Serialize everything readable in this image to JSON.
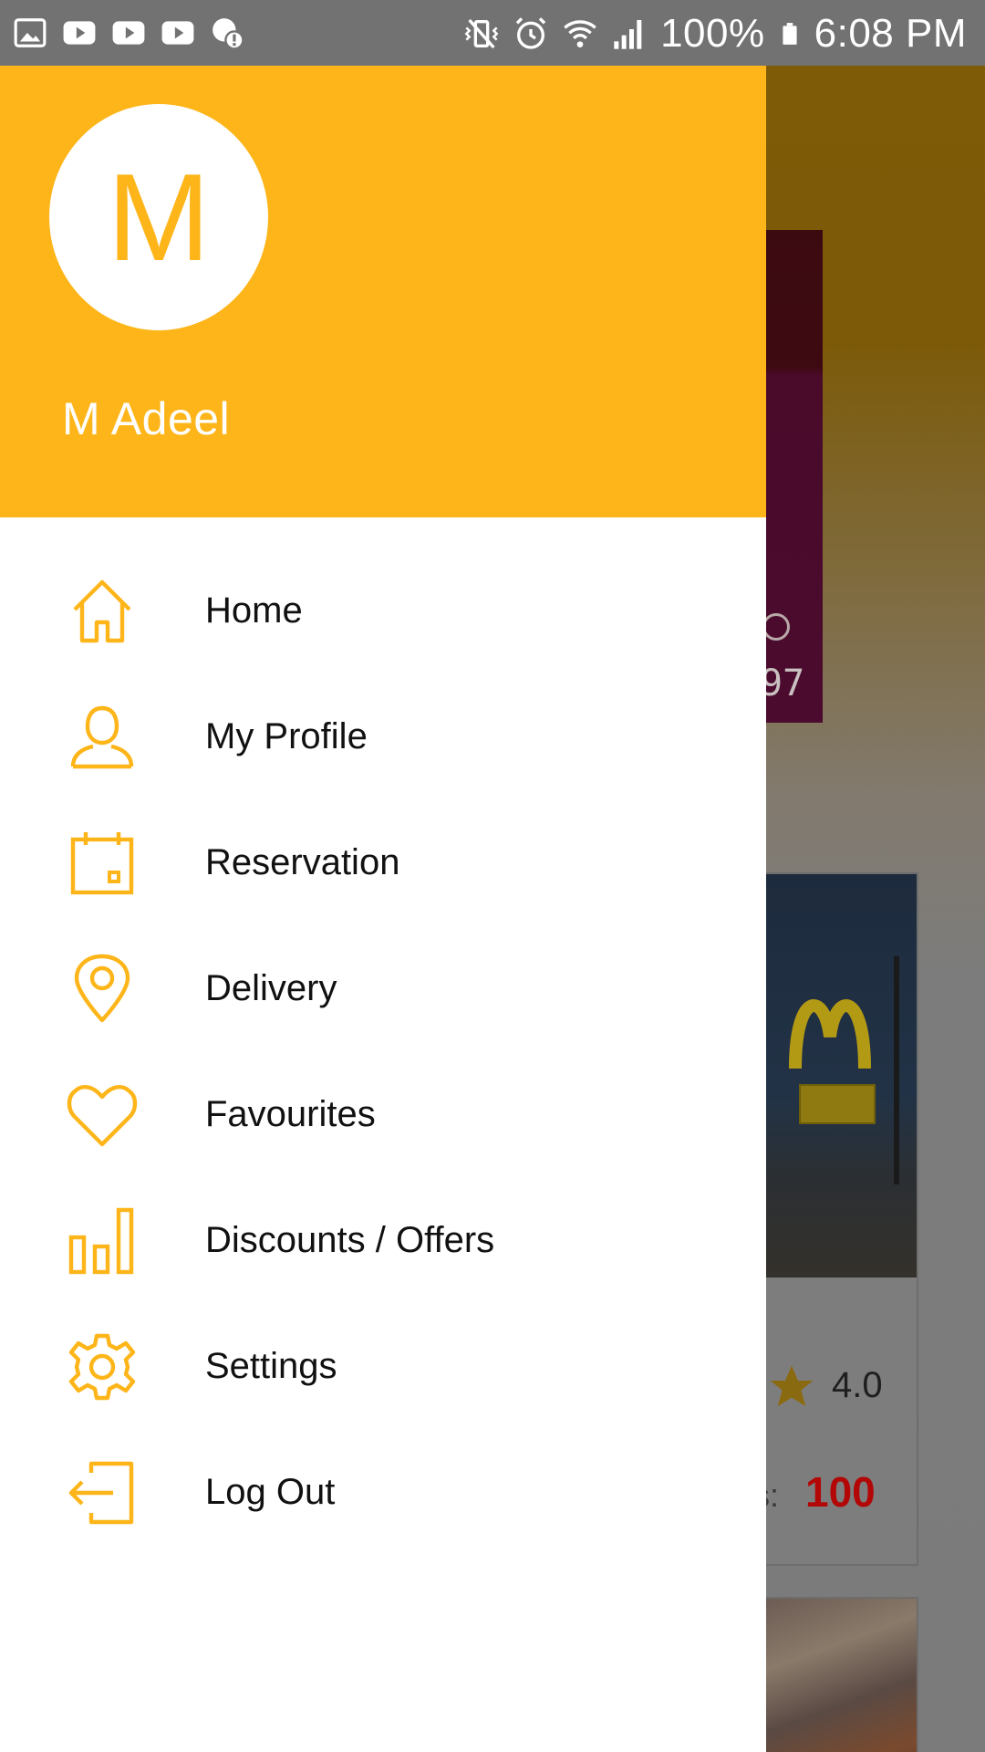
{
  "status_bar": {
    "battery": "100%",
    "time": "6:08 PM",
    "left_icons": [
      "gallery-icon",
      "youtube-icon",
      "youtube-icon",
      "youtube-icon",
      "data-alert-icon"
    ],
    "right_icons": [
      "vibrate-icon",
      "alarm-icon",
      "wifi-icon",
      "signal-icon",
      "battery-icon"
    ]
  },
  "drawer": {
    "avatar_letter": "M",
    "user_name": "M Adeel",
    "accent_color": "#fdb519",
    "items": [
      {
        "label": "Home",
        "icon": "home-icon"
      },
      {
        "label": "My Profile",
        "icon": "user-icon"
      },
      {
        "label": "Reservation",
        "icon": "calendar-icon"
      },
      {
        "label": "Delivery",
        "icon": "location-pin-icon"
      },
      {
        "label": "Favourites",
        "icon": "heart-icon"
      },
      {
        "label": "Discounts / Offers",
        "icon": "bar-chart-icon"
      },
      {
        "label": "Settings",
        "icon": "gear-icon"
      },
      {
        "label": "Log Out",
        "icon": "logout-icon"
      }
    ]
  },
  "background": {
    "banner_text": "97",
    "rating": "4.0",
    "price_label": "s:",
    "price": "100",
    "price_color": "#b30707"
  }
}
